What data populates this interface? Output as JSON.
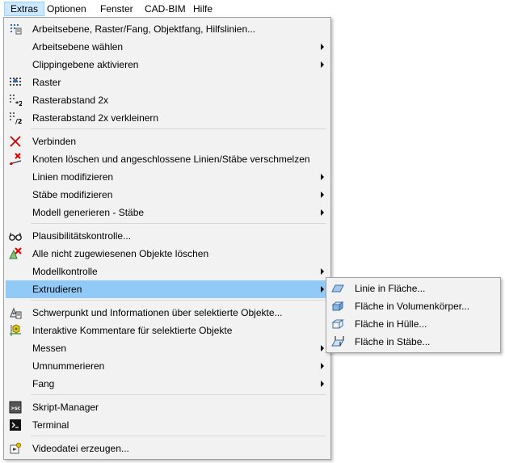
{
  "menubar": {
    "items": [
      {
        "label": "Extras"
      },
      {
        "label": "Optionen"
      },
      {
        "label": "Fenster"
      },
      {
        "label": "CAD-BIM"
      },
      {
        "label": "Hilfe"
      }
    ]
  },
  "menu": {
    "items": [
      {
        "label": "Arbeitsebene, Raster/Fang, Objektfang, Hilfslinien...",
        "icon": "grid-settings-icon"
      },
      {
        "label": "Arbeitsebene wählen",
        "submenu": true
      },
      {
        "label": "Clippingebene aktivieren",
        "submenu": true
      },
      {
        "label": "Raster",
        "icon": "grid-icon"
      },
      {
        "label": "Rasterabstand 2x",
        "icon": "grid-double-icon"
      },
      {
        "label": "Rasterabstand 2x verkleinern",
        "icon": "grid-halve-icon"
      },
      {
        "label": "Verbinden",
        "icon": "connect-icon"
      },
      {
        "label": "Knoten löschen und angeschlossene Linien/Stäbe verschmelzen",
        "icon": "delete-node-icon"
      },
      {
        "label": "Linien modifizieren",
        "submenu": true
      },
      {
        "label": "Stäbe modifizieren",
        "submenu": true
      },
      {
        "label": "Modell generieren - Stäbe",
        "submenu": true
      },
      {
        "label": "Plausibilitätskontrolle...",
        "icon": "glasses-icon"
      },
      {
        "label": "Alle nicht zugewiesenen Objekte löschen",
        "icon": "delete-unassigned-icon"
      },
      {
        "label": "Modellkontrolle",
        "submenu": true
      },
      {
        "label": "Extrudieren",
        "submenu": true,
        "highlighted": true
      },
      {
        "label": "Schwerpunkt und Informationen über selektierte Objekte...",
        "icon": "centroid-info-icon"
      },
      {
        "label": "Interaktive Kommentare für selektierte Objekte",
        "icon": "comment-icon"
      },
      {
        "label": "Messen",
        "submenu": true
      },
      {
        "label": "Umnummerieren",
        "submenu": true
      },
      {
        "label": "Fang",
        "submenu": true
      },
      {
        "label": "Skript-Manager",
        "icon": "script-manager-icon"
      },
      {
        "label": "Terminal",
        "icon": "terminal-icon"
      },
      {
        "label": "Videodatei erzeugen...",
        "icon": "video-icon"
      }
    ]
  },
  "submenu_extrude": {
    "items": [
      {
        "label": "Linie in Fläche...",
        "icon": "line-to-surface-icon"
      },
      {
        "label": "Fläche in Volumenkörper...",
        "icon": "surface-to-solid-icon"
      },
      {
        "label": "Fläche in Hülle...",
        "icon": "surface-to-shell-icon"
      },
      {
        "label": "Fläche in Stäbe...",
        "icon": "surface-to-members-icon"
      }
    ]
  },
  "colors": {
    "highlight": "#91c9f7",
    "menu_bg": "#f2f2f2",
    "menubar_active": "#cce8ff"
  }
}
